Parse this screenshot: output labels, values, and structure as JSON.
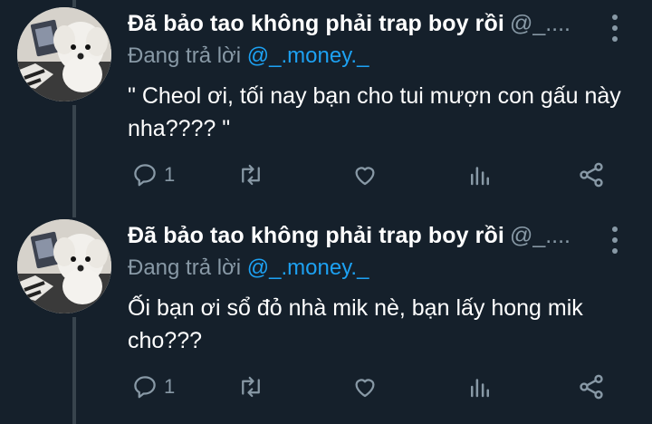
{
  "tweets": [
    {
      "display_name": "Đã bảo tao không phải trap boy rồi",
      "handle": "@_....",
      "reply_prefix": "Đang trả lời",
      "reply_to": "@_.money._",
      "text": "\" Cheol ơi, tối nay bạn cho tui mượn con gấu này nha???? \"",
      "reply_count": "1",
      "avatar_icon": "dog-photo-avatar"
    },
    {
      "display_name": "Đã bảo tao không phải trap boy rồi",
      "handle": "@_....",
      "reply_prefix": "Đang trả lời",
      "reply_to": "@_.money._",
      "text": "Ối bạn ơi sổ đỏ nhà mik nè, bạn lấy hong mik cho???",
      "reply_count": "1",
      "avatar_icon": "dog-photo-avatar"
    }
  ],
  "icons": {
    "reply": "reply-icon",
    "retweet": "retweet-icon",
    "like": "heart-icon",
    "analytics": "analytics-icon",
    "share": "share-icon",
    "more": "more-vertical-icon"
  },
  "colors": {
    "background": "#15202b",
    "primary_text": "#ffffff",
    "secondary_text": "#8899a6",
    "accent": "#1da1f2",
    "thread_line": "#38444d"
  }
}
